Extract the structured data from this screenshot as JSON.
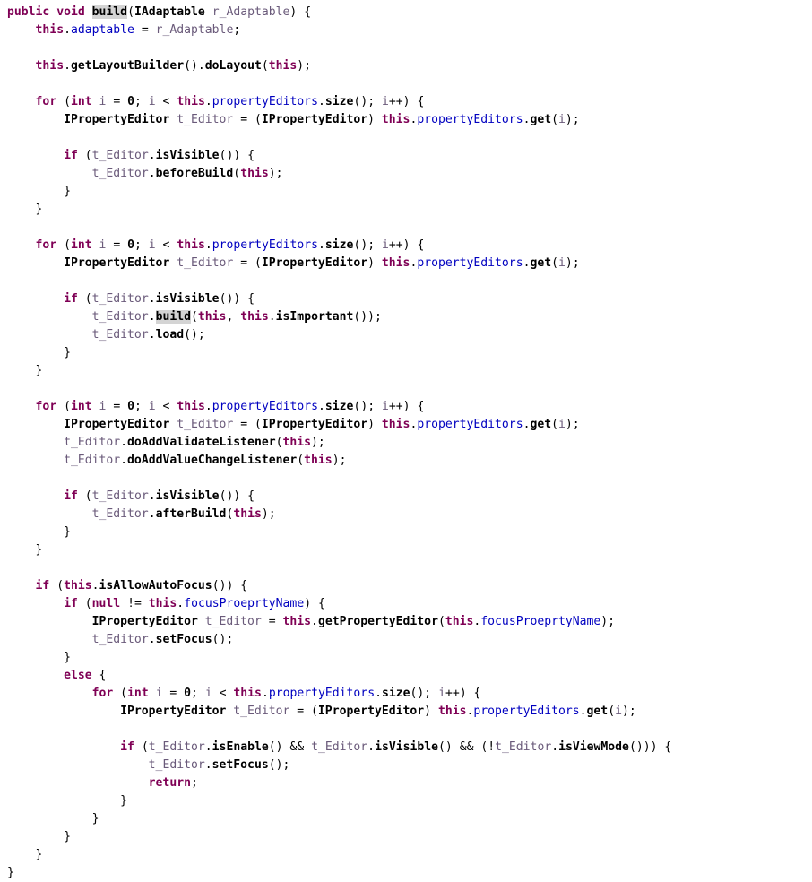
{
  "document": {
    "kind": "source-code-listing",
    "language": "Java",
    "background_color": "#ffffff",
    "highlighted_token": "build",
    "colors": {
      "keyword": "#7f0055",
      "field": "#0000c0",
      "local_variable": "#6a5a7a",
      "type": "#000000",
      "method": "#000000",
      "plain": "#000000",
      "occurrence_highlight": "#d4d4d4"
    },
    "lines": [
      "public void build(IAdaptable r_Adaptable) {",
      "    this.adaptable = r_Adaptable;",
      "",
      "    this.getLayoutBuilder().doLayout(this);",
      "",
      "    for (int i = 0; i < this.propertyEditors.size(); i++) {",
      "        IPropertyEditor t_Editor = (IPropertyEditor) this.propertyEditors.get(i);",
      "",
      "        if (t_Editor.isVisible()) {",
      "            t_Editor.beforeBuild(this);",
      "        }",
      "    }",
      "",
      "    for (int i = 0; i < this.propertyEditors.size(); i++) {",
      "        IPropertyEditor t_Editor = (IPropertyEditor) this.propertyEditors.get(i);",
      "",
      "        if (t_Editor.isVisible()) {",
      "            t_Editor.build(this, this.isImportant());",
      "            t_Editor.load();",
      "        }",
      "    }",
      "",
      "    for (int i = 0; i < this.propertyEditors.size(); i++) {",
      "        IPropertyEditor t_Editor = (IPropertyEditor) this.propertyEditors.get(i);",
      "        t_Editor.doAddValidateListener(this);",
      "        t_Editor.doAddValueChangeListener(this);",
      "",
      "        if (t_Editor.isVisible()) {",
      "            t_Editor.afterBuild(this);",
      "        }",
      "    }",
      "",
      "    if (this.isAllowAutoFocus()) {",
      "        if (null != this.focusProeprtyName) {",
      "            IPropertyEditor t_Editor = this.getPropertyEditor(this.focusProeprtyName);",
      "            t_Editor.setFocus();",
      "        }",
      "        else {",
      "            for (int i = 0; i < this.propertyEditors.size(); i++) {",
      "                IPropertyEditor t_Editor = (IPropertyEditor) this.propertyEditors.get(i);",
      "",
      "                if (t_Editor.isEnable() && t_Editor.isVisible() && (!t_Editor.isViewMode())) {",
      "                    t_Editor.setFocus();",
      "                    return;",
      "                }",
      "            }",
      "        }",
      "    }",
      "}"
    ]
  }
}
